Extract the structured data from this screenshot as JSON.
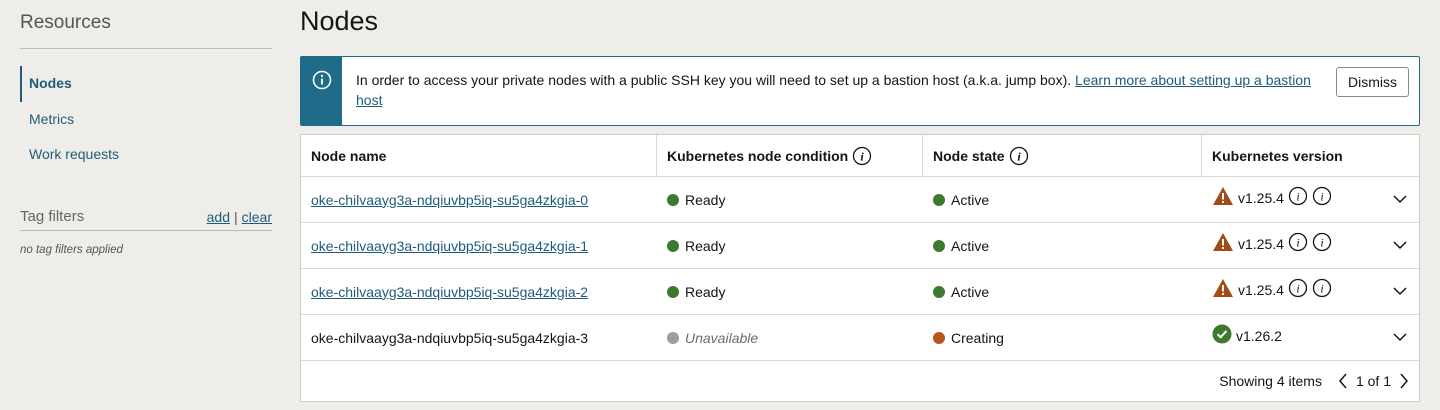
{
  "sidebar": {
    "title": "Resources",
    "items": [
      {
        "label": "Nodes",
        "active": true
      },
      {
        "label": "Metrics",
        "active": false
      },
      {
        "label": "Work requests",
        "active": false
      }
    ],
    "tag_filters": {
      "title": "Tag filters",
      "add": "add",
      "separator": "|",
      "clear": "clear",
      "empty": "no tag filters applied"
    }
  },
  "page_title": "Nodes",
  "banner": {
    "icon": "info-icon",
    "text": "In order to access your private nodes with a public SSH key you will need to set up a bastion host (a.k.a. jump box). ",
    "link": "Learn more about setting up a bastion host",
    "dismiss": "Dismiss"
  },
  "table": {
    "headers": {
      "name": "Node name",
      "condition": "Kubernetes node condition",
      "state": "Node state",
      "version": "Kubernetes version"
    },
    "rows": [
      {
        "name": "oke-chilvaayg3a-ndqiuvbp5iq-su5ga4zkgia-0",
        "condition": "Ready",
        "state": "Active",
        "version": "v1.25.4"
      },
      {
        "name": "oke-chilvaayg3a-ndqiuvbp5iq-su5ga4zkgia-1",
        "condition": "Ready",
        "state": "Active",
        "version": "v1.25.4"
      },
      {
        "name": "oke-chilvaayg3a-ndqiuvbp5iq-su5ga4zkgia-2",
        "condition": "Ready",
        "state": "Active",
        "version": "v1.25.4"
      },
      {
        "name": "oke-chilvaayg3a-ndqiuvbp5iq-su5ga4zkgia-3",
        "condition": "Unavailable",
        "state": "Creating",
        "version": "v1.26.2"
      }
    ],
    "footer": {
      "showing": "Showing 4 items",
      "page": "1 of 1"
    }
  },
  "colors": {
    "link": "#1f5c7a",
    "banner_accent": "#1f6b8a",
    "ready_green": "#3d7a2f",
    "unavailable_gray": "#a09c97",
    "creating_orange": "#b7541c",
    "warning_orange": "#a34b16",
    "success_green": "#3d7a2f"
  }
}
